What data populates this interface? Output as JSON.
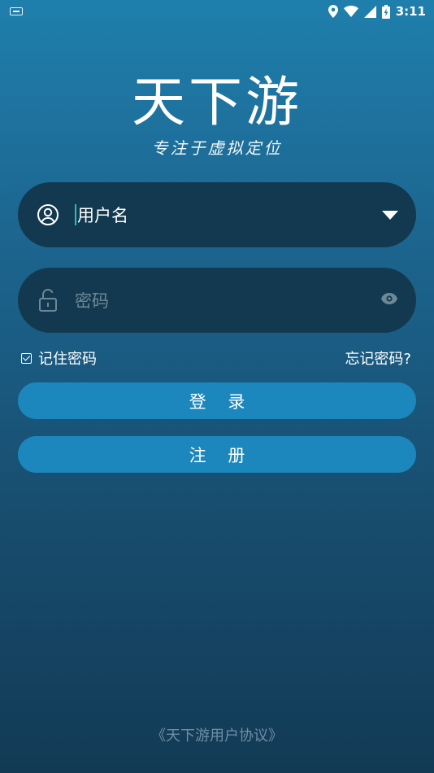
{
  "status_bar": {
    "time": "3:11",
    "icons": [
      "keyboard-icon",
      "location-icon",
      "wifi-icon",
      "signal-icon",
      "battery-charging-icon"
    ]
  },
  "brand": {
    "title": "天下游",
    "slogan": "专注于虚拟定位"
  },
  "login_form": {
    "username_value": "用户名",
    "password_placeholder": "密码",
    "remember_label": "记住密码",
    "forgot_label": "忘记密码?",
    "login_button": "登 录",
    "register_button": "注 册"
  },
  "footer": {
    "agreement_link": "《天下游用户协议》"
  },
  "colors": {
    "accent": "#1c87bd",
    "field_bg": "#12394f",
    "cursor": "#28c0b8"
  }
}
